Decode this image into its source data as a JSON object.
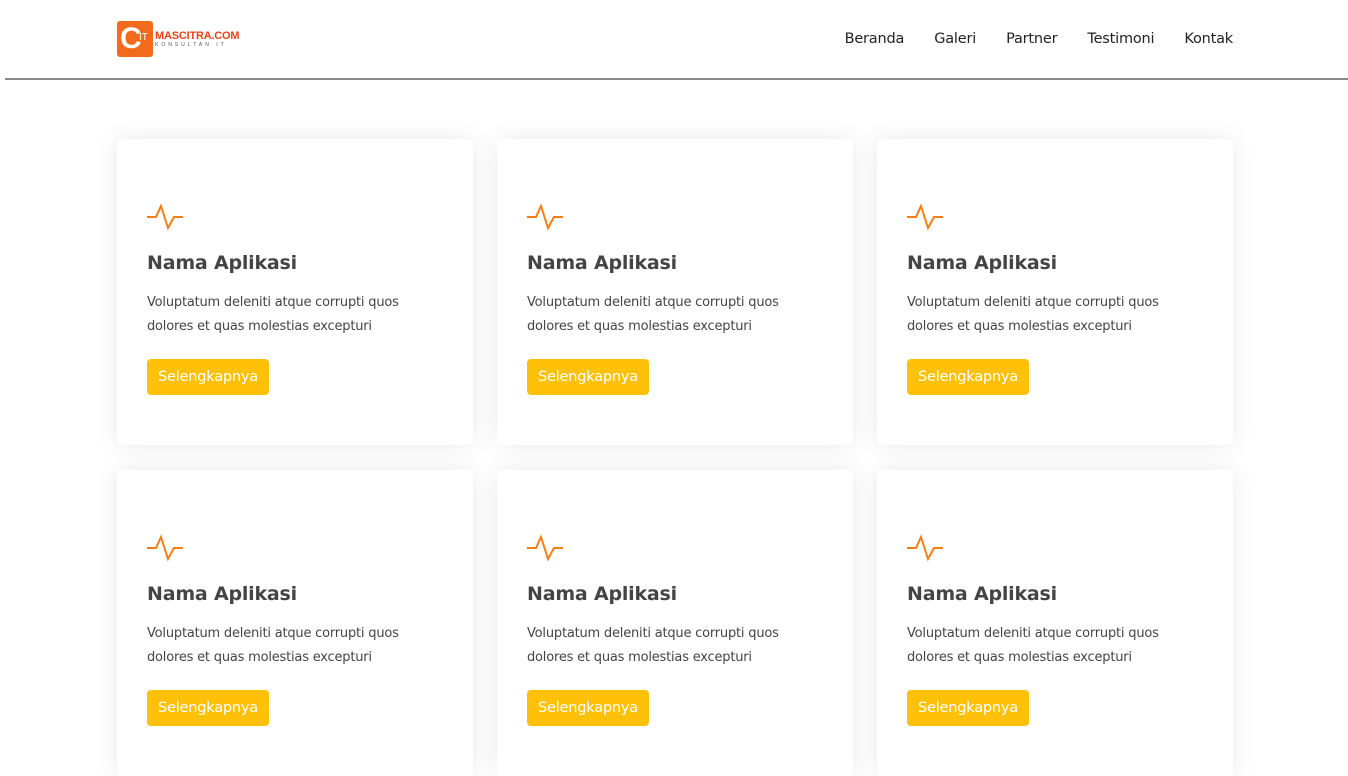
{
  "header": {
    "logo": {
      "mark_letter": "C",
      "mark_sub": "IT",
      "name": "MASCITRA.COM",
      "tagline": "KONSULTAN IT"
    },
    "nav": [
      "Beranda",
      "Galeri",
      "Partner",
      "Testimoni",
      "Kontak"
    ]
  },
  "cards": [
    {
      "icon": "activity-pulse-icon",
      "title": "Nama Aplikasi",
      "description": "Voluptatum deleniti atque corrupti quos dolores et quas molestias excepturi",
      "button": "Selengkapnya"
    },
    {
      "icon": "activity-pulse-icon",
      "title": "Nama Aplikasi",
      "description": "Voluptatum deleniti atque corrupti quos dolores et quas molestias excepturi",
      "button": "Selengkapnya"
    },
    {
      "icon": "activity-pulse-icon",
      "title": "Nama Aplikasi",
      "description": "Voluptatum deleniti atque corrupti quos dolores et quas molestias excepturi",
      "button": "Selengkapnya"
    },
    {
      "icon": "activity-pulse-icon",
      "title": "Nama Aplikasi",
      "description": "Voluptatum deleniti atque corrupti quos dolores et quas molestias excepturi",
      "button": "Selengkapnya"
    },
    {
      "icon": "activity-pulse-icon",
      "title": "Nama Aplikasi",
      "description": "Voluptatum deleniti atque corrupti quos dolores et quas molestias excepturi",
      "button": "Selengkapnya"
    },
    {
      "icon": "activity-pulse-icon",
      "title": "Nama Aplikasi",
      "description": "Voluptatum deleniti atque corrupti quos dolores et quas molestias excepturi",
      "button": "Selengkapnya"
    }
  ],
  "colors": {
    "accent": "#f26a1b",
    "icon": "#f57e14",
    "button": "#ffc107",
    "heading": "#444444"
  }
}
